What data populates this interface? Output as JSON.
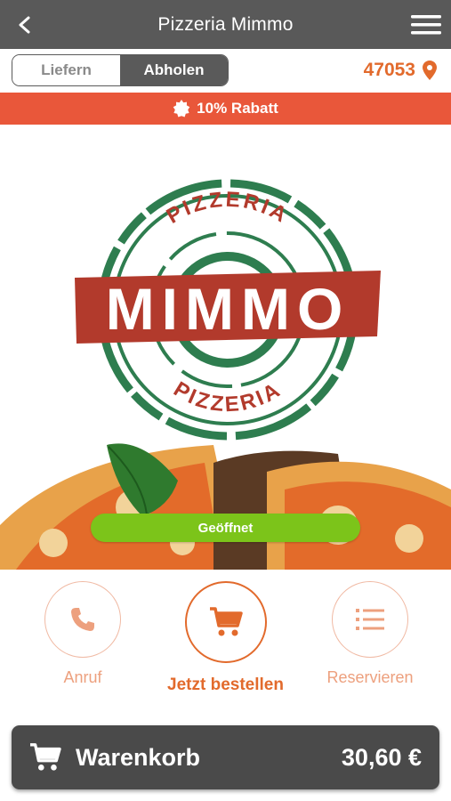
{
  "header": {
    "title": "Pizzeria Mimmo",
    "back_icon": "chevron-left-icon",
    "menu_icon": "hamburger-menu-icon"
  },
  "mode_toggle": {
    "options": [
      "Liefern",
      "Abholen"
    ],
    "selected": "Abholen"
  },
  "location": {
    "zip": "47053",
    "icon": "map-pin-icon"
  },
  "promo": {
    "text": "10% Rabatt",
    "icon": "badge-icon"
  },
  "logo": {
    "top_text": "PIZZERIA",
    "name": "MIMMO",
    "bottom_text": "PIZZERIA"
  },
  "status": {
    "label": "Geöffnet"
  },
  "actions": [
    {
      "label": "Anruf",
      "icon": "phone-icon"
    },
    {
      "label": "Jetzt bestellen",
      "icon": "cart-icon"
    },
    {
      "label": "Reservieren",
      "icon": "list-icon"
    }
  ],
  "cart": {
    "label": "Warenkorb",
    "total": "30,60 €",
    "icon": "cart-icon"
  },
  "colors": {
    "header_bg": "#595959",
    "accent": "#e26a2c",
    "promo_bg": "#e9573a",
    "open_green": "#7cc41a",
    "cart_bg": "#4a4a4a",
    "logo_red": "#b23a2c",
    "logo_green": "#2e7d4f"
  }
}
